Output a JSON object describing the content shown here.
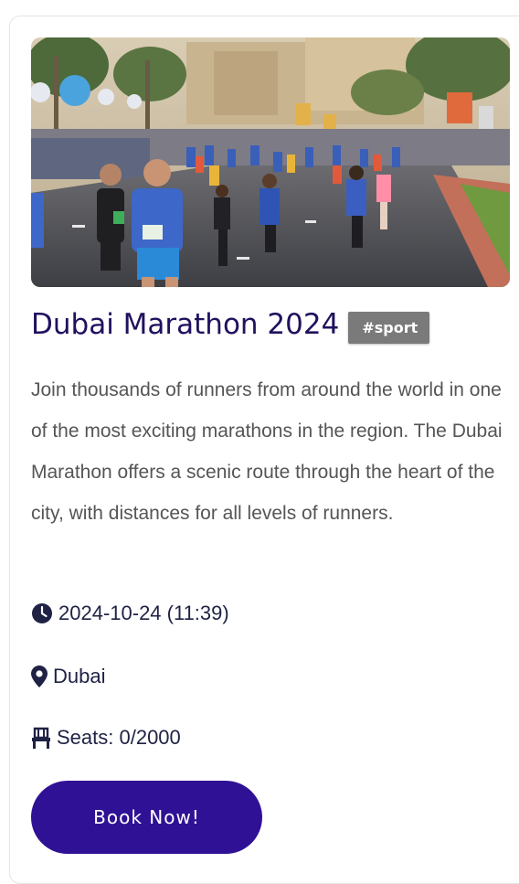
{
  "event": {
    "title": "Dubai Marathon 2024",
    "tag": "#sport",
    "description": "Join thousands of runners from around the world in one of the most exciting marathons in the region. The Dubai Marathon offers a scenic route through the heart of the city, with distances for all levels of runners.",
    "datetime": "2024-10-24 (11:39)",
    "location": "Dubai",
    "seats": "Seats: 0/2000",
    "book_label": "Book Now!",
    "image_icon": "marathon-runners-photo"
  },
  "icons": {
    "date": "clock-icon",
    "location": "map-pin-icon",
    "seats": "chair-icon"
  },
  "colors": {
    "title": "#21115e",
    "tag_bg": "#7a7a7a",
    "button": "#2f1195",
    "meta_text": "#1f2244",
    "description": "#555555"
  }
}
